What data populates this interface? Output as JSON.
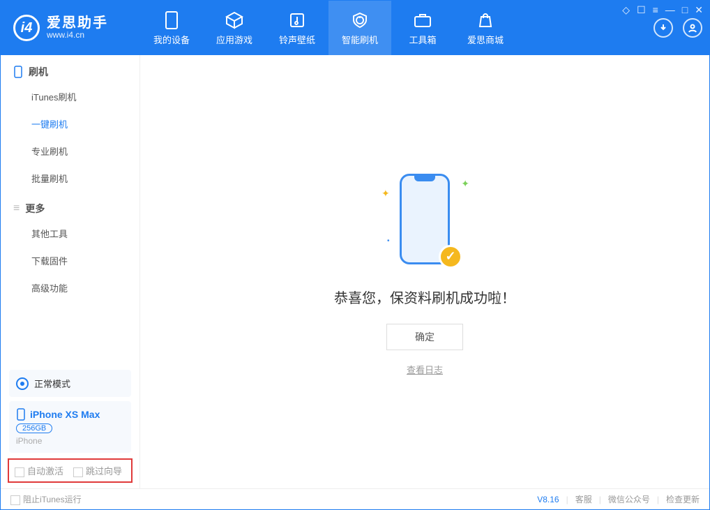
{
  "app": {
    "title": "爱思助手",
    "subtitle": "www.i4.cn"
  },
  "nav": {
    "items": [
      {
        "label": "我的设备"
      },
      {
        "label": "应用游戏"
      },
      {
        "label": "铃声壁纸"
      },
      {
        "label": "智能刷机"
      },
      {
        "label": "工具箱"
      },
      {
        "label": "爱思商城"
      }
    ],
    "active_index": 3
  },
  "sidebar": {
    "group1_title": "刷机",
    "group1_items": [
      "iTunes刷机",
      "一键刷机",
      "专业刷机",
      "批量刷机"
    ],
    "group1_active": 1,
    "group2_title": "更多",
    "group2_items": [
      "其他工具",
      "下载固件",
      "高级功能"
    ]
  },
  "status_block": {
    "label": "正常模式"
  },
  "device": {
    "name": "iPhone XS Max",
    "capacity": "256GB",
    "type": "iPhone"
  },
  "checkboxes": {
    "auto_activate": "自动激活",
    "skip_guide": "跳过向导"
  },
  "main": {
    "success": "恭喜您，保资料刷机成功啦！",
    "ok": "确定",
    "view_log": "查看日志"
  },
  "statusbar": {
    "block_itunes": "阻止iTunes运行",
    "version": "V8.16",
    "links": [
      "客服",
      "微信公众号",
      "检查更新"
    ]
  }
}
